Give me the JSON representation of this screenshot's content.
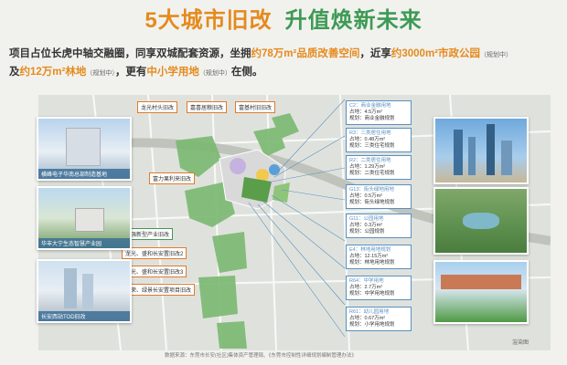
{
  "title": {
    "part1": "5大城市旧改",
    "part2": "升值焕新未来"
  },
  "intro": {
    "t1": "项目占位长虎中轴交融圈，同享双城配套资源，坐拥",
    "h1": "约78万m²品质改善空间",
    "t2": "，近享",
    "h2": "约3000m²市政公园",
    "s1": "（规划中）",
    "t3": "及",
    "h3": "约12万m²林地",
    "s2": "（规划中）",
    "t4": "，更有",
    "h4": "中小学用地",
    "s3": "（规划中）",
    "t5": "在侧。"
  },
  "labels": [
    {
      "id": "longguang",
      "text": "龙光村头旧改"
    },
    {
      "id": "jiaxi",
      "text": "嘉喜居粮旧改"
    },
    {
      "id": "fuji",
      "text": "富基村旧旧改"
    },
    {
      "id": "fuli",
      "text": "富力果利来旧改"
    },
    {
      "id": "huachuang",
      "text": "华强新型产业旧改"
    },
    {
      "id": "longguang2",
      "text": "龙光、盛和长安置旧改2"
    },
    {
      "id": "longguang3",
      "text": "龙光、盛和长安置旧改3"
    },
    {
      "id": "changrong",
      "text": "长荣、绿景长安置项目旧改"
    }
  ],
  "photos": [
    {
      "id": "p1",
      "caption": "横峰电子华南总部制造基地"
    },
    {
      "id": "p2",
      "caption": "华丰大宁生态智慧产业园"
    },
    {
      "id": "p3",
      "caption": "长安西站TOD旧改"
    }
  ],
  "infoboxes": [
    {
      "id": "c2",
      "lines": [
        "C2：商业金融用地",
        "占地：4.5万m²",
        "规划：商业金融规划"
      ]
    },
    {
      "id": "r3",
      "lines": [
        "R3：三类居住用地",
        "占地：0.48万m²",
        "规划：三类住宅规划"
      ]
    },
    {
      "id": "r2",
      "lines": [
        "R2：二类居住用地",
        "占地：1.29万m²",
        "规划：二类住宅规划"
      ]
    },
    {
      "id": "g13",
      "lines": [
        "G13：街头绿地用地",
        "占地：0.5万m²",
        "规划：街头绿地规划"
      ]
    },
    {
      "id": "g11",
      "lines": [
        "G11：公园用地",
        "占地：0.3万m²",
        "规划：公园规划"
      ]
    },
    {
      "id": "e4",
      "lines": [
        "E4：林地用地规划",
        "占地：12.15万m²",
        "规划：林地用地规划"
      ]
    },
    {
      "id": "r64",
      "lines": [
        "R64：中学用地",
        "占地：2.7万m²",
        "规划：中学用地规划"
      ]
    },
    {
      "id": "r61",
      "lines": [
        "R61：幼儿园用地",
        "占地：0.67万m²",
        "规划：小学用地规划"
      ]
    }
  ],
  "footer": "数据来源：东莞市长安(社区)集体资产管理局、《东莞市控制性详细规划编制管理办法》",
  "render_note": "渲染图"
}
